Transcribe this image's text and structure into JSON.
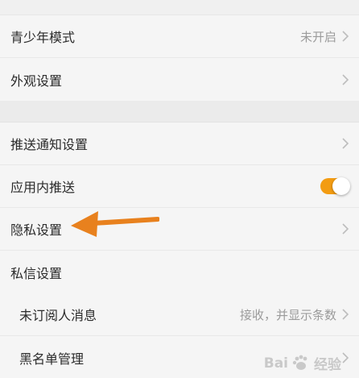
{
  "settings": {
    "teen_mode": {
      "label": "青少年模式",
      "value": "未开启"
    },
    "appearance": {
      "label": "外观设置"
    },
    "push": {
      "label": "推送通知设置"
    },
    "in_app_push": {
      "label": "应用内推送",
      "enabled": true
    },
    "privacy": {
      "label": "隐私设置"
    },
    "dm": {
      "label": "私信设置"
    },
    "unsubscribed_msg": {
      "label": "未订阅人消息",
      "value": "接收，并显示条数"
    },
    "blacklist": {
      "label": "黑名单管理"
    }
  },
  "colors": {
    "accent": "#f39c12",
    "annotation_arrow": "#e8811e",
    "text": "#2b2b2b",
    "muted": "#9b9b9b"
  },
  "watermark": {
    "brand": "Bai",
    "brand_suffix": "经验",
    "icon": "baidu-paw-icon"
  }
}
